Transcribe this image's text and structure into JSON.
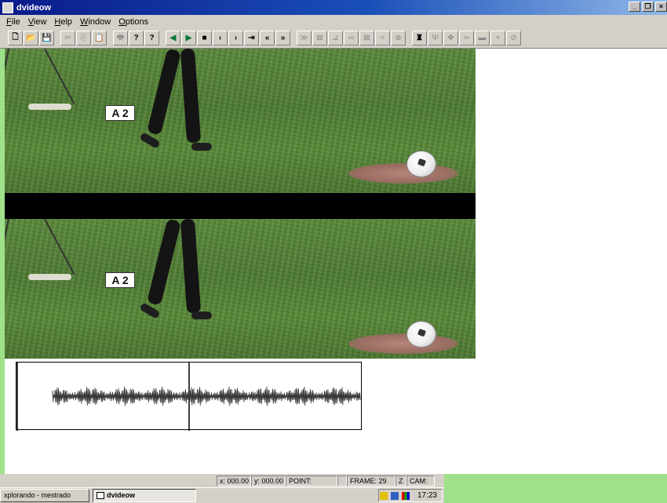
{
  "window": {
    "title": "dvideow"
  },
  "menu": [
    {
      "label": "File",
      "mnemonic": "F",
      "rest": "ile"
    },
    {
      "label": "View",
      "mnemonic": "V",
      "rest": "iew"
    },
    {
      "label": "Help",
      "mnemonic": "H",
      "rest": "elp"
    },
    {
      "label": "Window",
      "mnemonic": "W",
      "rest": "indow"
    },
    {
      "label": "Options",
      "mnemonic": "O",
      "rest": "ptions"
    }
  ],
  "toolbar": {
    "glyphs": {
      "new": "🗋",
      "open": "📂",
      "save": "💾",
      "cut": "✂",
      "copy": "⎘",
      "paste": "📋",
      "print": "🖶",
      "help": "?",
      "context_help": "?",
      "prev": "◀",
      "play": "▶",
      "stop": "■",
      "step_back": "‹",
      "step_fwd": "›",
      "end": "⇥",
      "rewind": "«",
      "fast_fwd": "»",
      "d1": "≫",
      "d2": "⊠",
      "d3": "⊿",
      "d4": "∞",
      "d5": "⊠",
      "d6": "≈",
      "d7": "⊗",
      "t1": "♜",
      "t2": "Ψ",
      "t3": "✥",
      "t4": "≃",
      "t5": "▬",
      "t6": "+",
      "t7": "⊘"
    }
  },
  "video": {
    "top_label": "A 2",
    "bottom_label": "A 2"
  },
  "statusbar": {
    "x": "x: 000.00",
    "y": "y: 000.00",
    "point": "POINT:",
    "blank": "",
    "frame": "FRAME: 29",
    "z": "Z",
    "cam": "CAM:"
  },
  "taskbar": {
    "item1": "xplorando - mestrado",
    "item2": "dvideow",
    "clock": "17:23"
  },
  "colors": {
    "title_start": "#0a1a8a",
    "title_end": "#8fb8e8",
    "desktop": "#9fe08a",
    "chrome": "#d4d0c8"
  }
}
